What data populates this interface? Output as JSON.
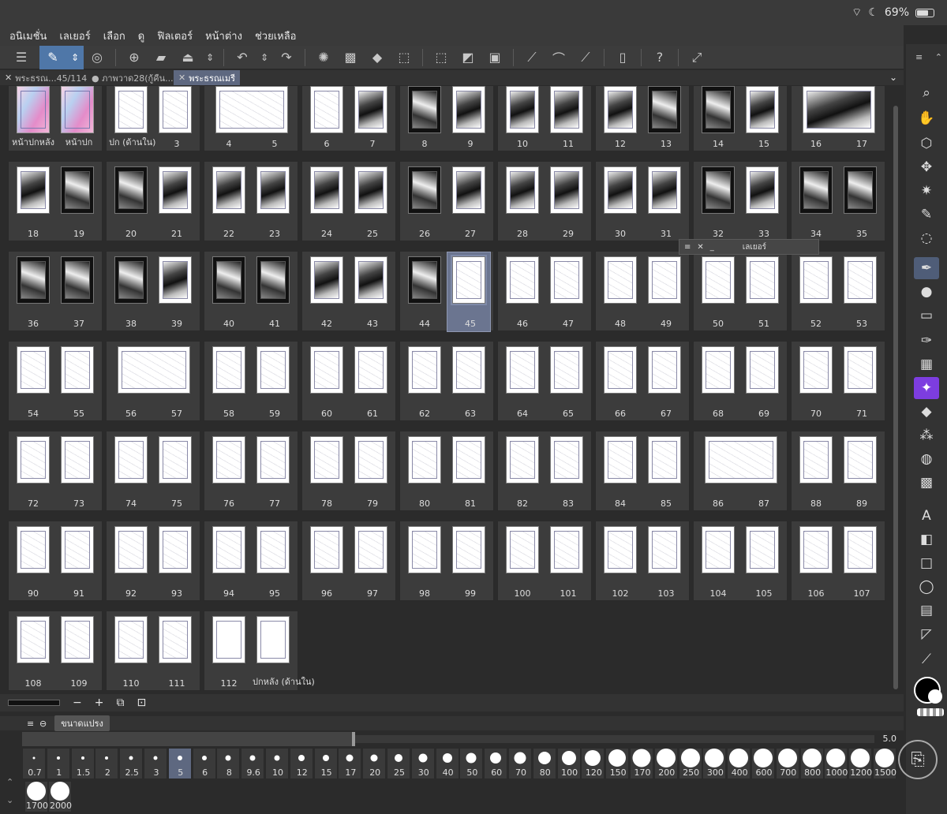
{
  "status": {
    "battery": "69%",
    "wifi_icon": "wifi-icon",
    "moon_icon": "moon-icon"
  },
  "menu": [
    "อนิเมชั่น",
    "เลเยอร์",
    "เลือก",
    "ดู",
    "ฟิลเตอร์",
    "หน้าต่าง",
    "ช่วยเหลือ"
  ],
  "tabs": [
    {
      "label": "พระธรณ...45/114",
      "active": false
    },
    {
      "label": "● ภาพวาด28(กู้คืน...",
      "active": false
    },
    {
      "label": "พระธรณเมรี",
      "active": true
    }
  ],
  "spreads": [
    {
      "labels": [
        "หน้าปกหลัง",
        "หน้าปก"
      ],
      "style": [
        "cover",
        "cover"
      ],
      "pair": true
    },
    {
      "labels": [
        "ปก (ด้านใน)",
        "3"
      ],
      "style": [
        "sk",
        "sk"
      ],
      "pair": true
    },
    {
      "labels": [
        "4",
        "5"
      ],
      "style": [
        "wide"
      ],
      "pair": false
    },
    {
      "labels": [
        "6",
        "7"
      ],
      "style": [
        "sk",
        "ink"
      ],
      "pair": true
    },
    {
      "labels": [
        "8",
        "9"
      ],
      "style": [
        "dark",
        "ink"
      ],
      "pair": true
    },
    {
      "labels": [
        "10",
        "11"
      ],
      "style": [
        "ink",
        "ink"
      ],
      "pair": true
    },
    {
      "labels": [
        "12",
        "13"
      ],
      "style": [
        "ink",
        "dark"
      ],
      "pair": true
    },
    {
      "labels": [
        "14",
        "15"
      ],
      "style": [
        "dark",
        "ink"
      ],
      "pair": true
    },
    {
      "labels": [
        "16",
        "17"
      ],
      "style": [
        "widedark"
      ],
      "pair": false
    },
    {
      "labels": [
        "18",
        "19"
      ],
      "style": [
        "ink",
        "dark"
      ],
      "pair": true
    },
    {
      "labels": [
        "20",
        "21"
      ],
      "style": [
        "dark",
        "ink"
      ],
      "pair": true
    },
    {
      "labels": [
        "22",
        "23"
      ],
      "style": [
        "ink",
        "ink"
      ],
      "pair": true
    },
    {
      "labels": [
        "24",
        "25"
      ],
      "style": [
        "ink",
        "ink"
      ],
      "pair": true
    },
    {
      "labels": [
        "26",
        "27"
      ],
      "style": [
        "dark",
        "ink"
      ],
      "pair": true
    },
    {
      "labels": [
        "28",
        "29"
      ],
      "style": [
        "ink",
        "ink"
      ],
      "pair": true
    },
    {
      "labels": [
        "30",
        "31"
      ],
      "style": [
        "ink",
        "ink"
      ],
      "pair": true
    },
    {
      "labels": [
        "32",
        "33"
      ],
      "style": [
        "dark",
        "ink"
      ],
      "pair": true
    },
    {
      "labels": [
        "34",
        "35"
      ],
      "style": [
        "dark",
        "dark"
      ],
      "pair": true
    },
    {
      "labels": [
        "36",
        "37"
      ],
      "style": [
        "dark",
        "dark"
      ],
      "pair": true
    },
    {
      "labels": [
        "38",
        "39"
      ],
      "style": [
        "dark",
        "ink"
      ],
      "pair": true
    },
    {
      "labels": [
        "40",
        "41"
      ],
      "style": [
        "dark",
        "dark"
      ],
      "pair": true
    },
    {
      "labels": [
        "42",
        "43"
      ],
      "style": [
        "ink",
        "ink"
      ],
      "pair": true
    },
    {
      "labels": [
        "44",
        "45"
      ],
      "style": [
        "dark",
        "sk"
      ],
      "pair": true,
      "selected_second": true
    },
    {
      "labels": [
        "46",
        "47"
      ],
      "style": [
        "sk",
        "sk"
      ],
      "pair": true
    },
    {
      "labels": [
        "48",
        "49"
      ],
      "style": [
        "sk",
        "sk"
      ],
      "pair": true
    },
    {
      "labels": [
        "50",
        "51"
      ],
      "style": [
        "sk",
        "sk"
      ],
      "pair": true
    },
    {
      "labels": [
        "52",
        "53"
      ],
      "style": [
        "sk",
        "sk"
      ],
      "pair": true
    },
    {
      "labels": [
        "54",
        "55"
      ],
      "style": [
        "sk",
        "sk"
      ],
      "pair": true
    },
    {
      "labels": [
        "56",
        "57"
      ],
      "style": [
        "wide"
      ],
      "pair": false
    },
    {
      "labels": [
        "58",
        "59"
      ],
      "style": [
        "sk",
        "sk"
      ],
      "pair": true
    },
    {
      "labels": [
        "60",
        "61"
      ],
      "style": [
        "sk",
        "sk"
      ],
      "pair": true
    },
    {
      "labels": [
        "62",
        "63"
      ],
      "style": [
        "sk",
        "sk"
      ],
      "pair": true
    },
    {
      "labels": [
        "64",
        "65"
      ],
      "style": [
        "sk",
        "sk"
      ],
      "pair": true
    },
    {
      "labels": [
        "66",
        "67"
      ],
      "style": [
        "sk",
        "sk"
      ],
      "pair": true
    },
    {
      "labels": [
        "68",
        "69"
      ],
      "style": [
        "sk",
        "sk"
      ],
      "pair": true
    },
    {
      "labels": [
        "70",
        "71"
      ],
      "style": [
        "sk",
        "sk"
      ],
      "pair": true
    },
    {
      "labels": [
        "72",
        "73"
      ],
      "style": [
        "sk",
        "sk"
      ],
      "pair": true
    },
    {
      "labels": [
        "74",
        "75"
      ],
      "style": [
        "sk",
        "sk"
      ],
      "pair": true
    },
    {
      "labels": [
        "76",
        "77"
      ],
      "style": [
        "sk",
        "sk"
      ],
      "pair": true
    },
    {
      "labels": [
        "78",
        "79"
      ],
      "style": [
        "sk",
        "sk"
      ],
      "pair": true
    },
    {
      "labels": [
        "80",
        "81"
      ],
      "style": [
        "sk",
        "sk"
      ],
      "pair": true
    },
    {
      "labels": [
        "82",
        "83"
      ],
      "style": [
        "sk",
        "sk"
      ],
      "pair": true
    },
    {
      "labels": [
        "84",
        "85"
      ],
      "style": [
        "sk",
        "sk"
      ],
      "pair": true
    },
    {
      "labels": [
        "86",
        "87"
      ],
      "style": [
        "wide"
      ],
      "pair": false
    },
    {
      "labels": [
        "88",
        "89"
      ],
      "style": [
        "sk",
        "sk"
      ],
      "pair": true
    },
    {
      "labels": [
        "90",
        "91"
      ],
      "style": [
        "sk",
        "sk"
      ],
      "pair": true
    },
    {
      "labels": [
        "92",
        "93"
      ],
      "style": [
        "sk",
        "sk"
      ],
      "pair": true
    },
    {
      "labels": [
        "94",
        "95"
      ],
      "style": [
        "sk",
        "sk"
      ],
      "pair": true
    },
    {
      "labels": [
        "96",
        "97"
      ],
      "style": [
        "sk",
        "sk"
      ],
      "pair": true
    },
    {
      "labels": [
        "98",
        "99"
      ],
      "style": [
        "sk",
        "sk"
      ],
      "pair": true
    },
    {
      "labels": [
        "100",
        "101"
      ],
      "style": [
        "sk",
        "sk"
      ],
      "pair": true
    },
    {
      "labels": [
        "102",
        "103"
      ],
      "style": [
        "sk",
        "sk"
      ],
      "pair": true
    },
    {
      "labels": [
        "104",
        "105"
      ],
      "style": [
        "sk",
        "sk"
      ],
      "pair": true
    },
    {
      "labels": [
        "106",
        "107"
      ],
      "style": [
        "sk",
        "sk"
      ],
      "pair": true
    },
    {
      "labels": [
        "108",
        "109"
      ],
      "style": [
        "sk",
        "sk"
      ],
      "pair": true
    },
    {
      "labels": [
        "110",
        "111"
      ],
      "style": [
        "sk",
        "sk"
      ],
      "pair": true
    },
    {
      "labels": [
        "112",
        "ปกหลัง (ด้านใน)"
      ],
      "style": [
        "blank",
        "blank"
      ],
      "pair": true
    }
  ],
  "layer_panel": {
    "title": "เลเยอร์"
  },
  "zoom_bar": {
    "minus": "−",
    "plus": "+"
  },
  "brush_panel": {
    "tab_label": "ขนาดแปรง",
    "current_value": "5.0",
    "sizes": [
      "0.7",
      "1",
      "1.5",
      "2",
      "2.5",
      "3",
      "5",
      "6",
      "8",
      "9.6",
      "10",
      "12",
      "15",
      "17",
      "20",
      "25",
      "30",
      "40",
      "50",
      "60",
      "70",
      "80",
      "100",
      "120",
      "150",
      "170",
      "200",
      "250",
      "300",
      "400",
      "600",
      "700",
      "800",
      "1000",
      "1200",
      "1500",
      "1700",
      "2000"
    ],
    "selected": "5"
  },
  "right_tools": [
    "search-icon",
    "hand-icon",
    "rotate-3d-icon",
    "move-icon",
    "sparkle-icon",
    "eyedropper-icon",
    "lasso-icon",
    "pen-icon",
    "ink-icon",
    "eraser-icon",
    "brush-icon",
    "pattern-icon",
    "magic-icon",
    "fill-icon",
    "spray-icon",
    "blend-icon",
    "grid-icon",
    "text-icon",
    "gradient-icon",
    "rectangle-icon",
    "speech-bubble-icon",
    "frame-icon",
    "ruler-icon",
    "correction-icon"
  ],
  "right_tool_glyphs": [
    "⌕",
    "✋",
    "⬡",
    "✥",
    "✷",
    "✎",
    "◌",
    "✒",
    "●",
    "▭",
    "✑",
    "▦",
    "✦",
    "◆",
    "⁂",
    "◍",
    "▩",
    "A",
    "◧",
    "□",
    "◯",
    "▤",
    "◸",
    "⟋"
  ],
  "colors": {
    "accent": "#4f77a8",
    "selected_tab": "#5e6880",
    "main_color": "#000000",
    "sub_color": "#ffffff"
  }
}
